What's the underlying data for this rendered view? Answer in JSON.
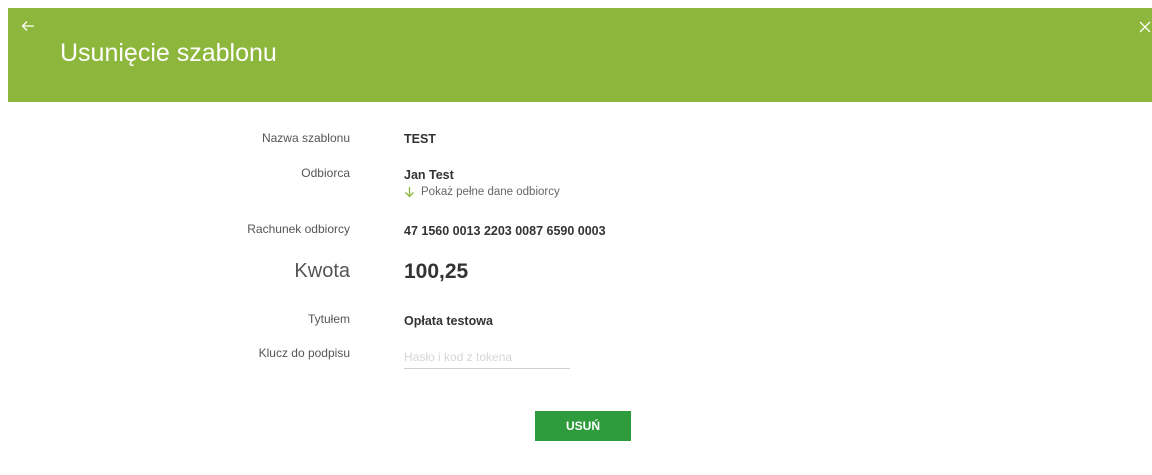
{
  "header": {
    "title": "Usunięcie szablonu",
    "back_icon": "arrow-left-icon",
    "close_icon": "close-icon",
    "background_color": "#8db63c"
  },
  "form": {
    "template_name": {
      "label": "Nazwa szablonu",
      "value": "TEST"
    },
    "recipient": {
      "label": "Odbiorca",
      "value": "Jan Test",
      "toggle_label": "Pokaż pełne dane odbiorcy",
      "toggle_icon": "arrow-down-icon"
    },
    "account": {
      "label": "Rachunek odbiorcy",
      "value": "47 1560 0013 2203 0087 6590 0003"
    },
    "amount": {
      "label": "Kwota",
      "value": "100,25"
    },
    "title_field": {
      "label": "Tytułem",
      "value": "Opłata testowa"
    },
    "signature": {
      "label": "Klucz do podpisu",
      "value": "",
      "placeholder": "Hasło i kod z tokena"
    }
  },
  "actions": {
    "delete_label": "USUŃ",
    "delete_color": "#2e9b3c"
  }
}
